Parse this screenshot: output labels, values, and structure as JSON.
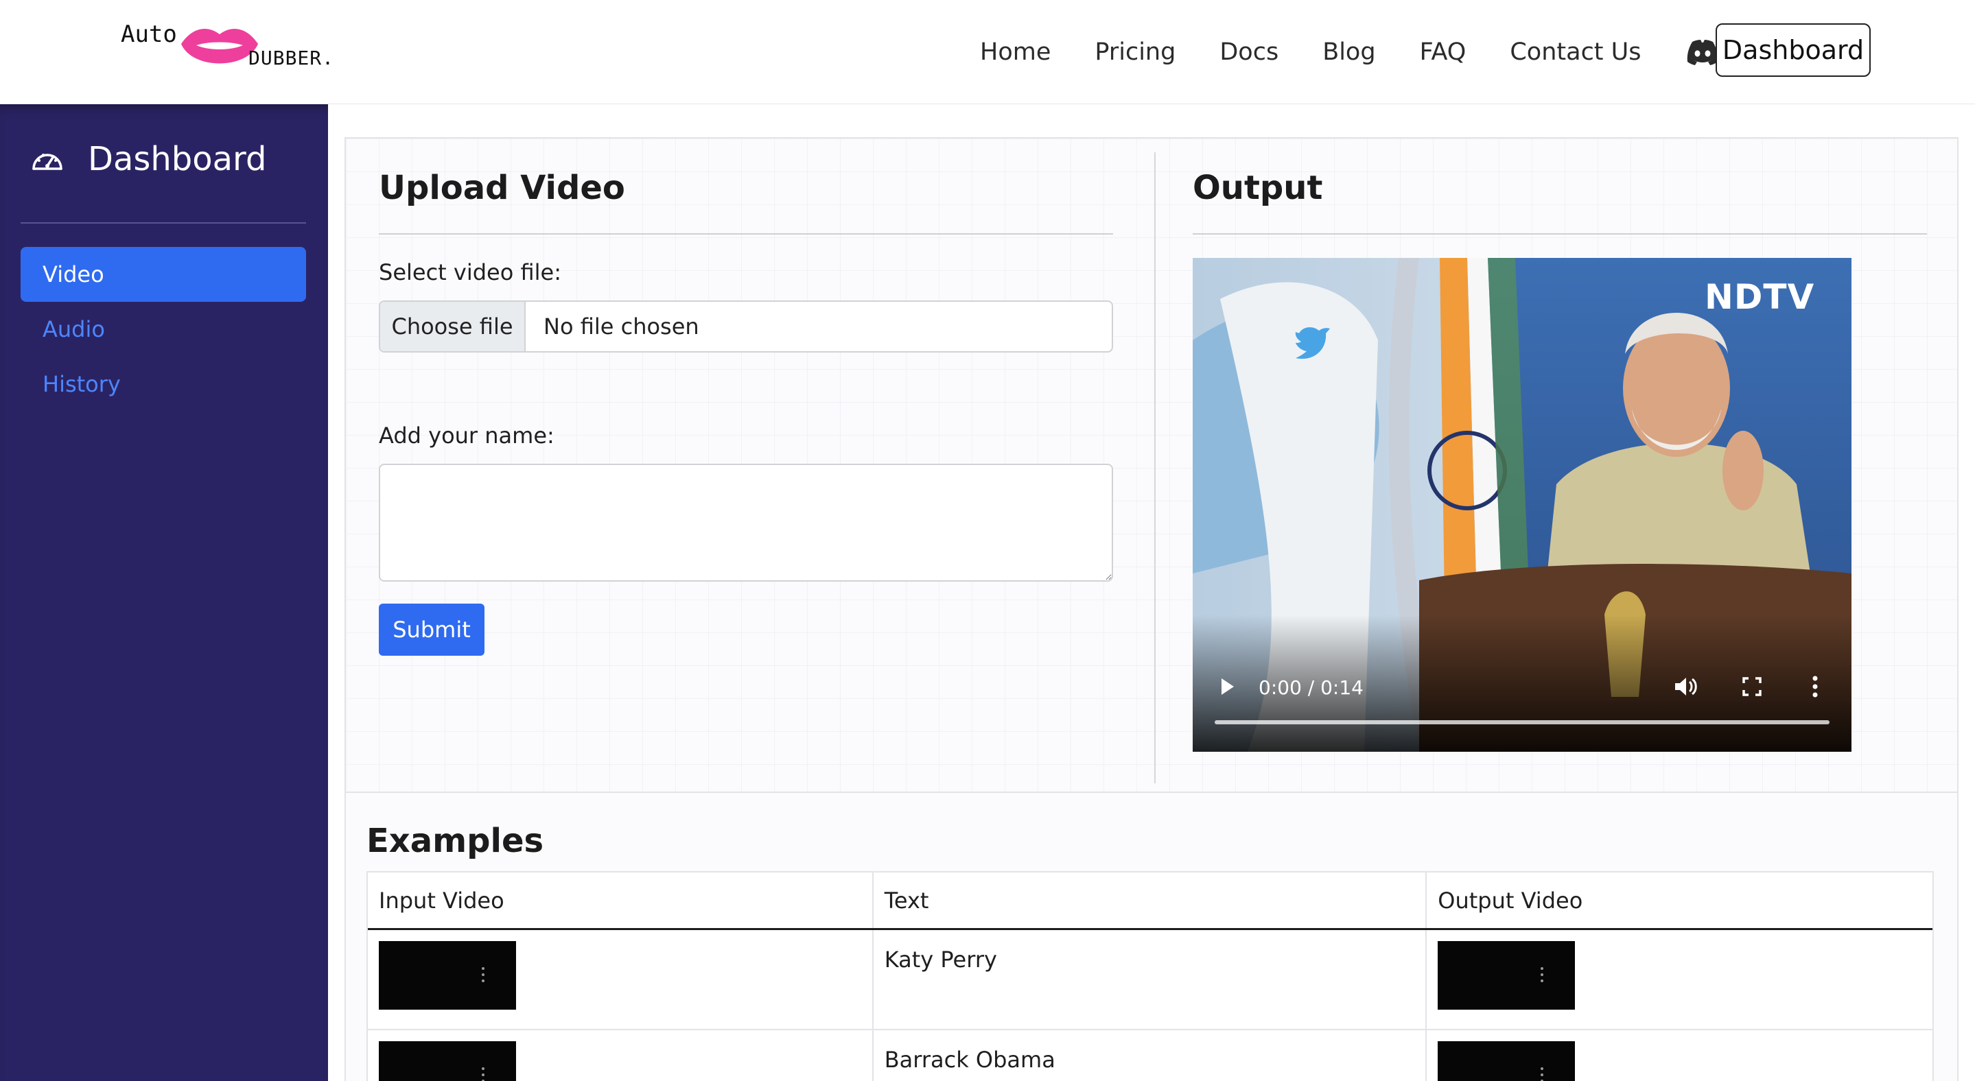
{
  "brand": {
    "logo_top": "Auto",
    "logo_bottom": "DUBBER."
  },
  "nav": {
    "links": [
      "Home",
      "Pricing",
      "Docs",
      "Blog",
      "FAQ",
      "Contact Us"
    ],
    "discord_icon": "discord-icon",
    "dashboard_button": "Dashboard"
  },
  "sidebar": {
    "title": "Dashboard",
    "title_icon": "speedometer-icon",
    "items": [
      {
        "label": "Video",
        "active": true
      },
      {
        "label": "Audio",
        "active": false
      },
      {
        "label": "History",
        "active": false
      }
    ]
  },
  "upload": {
    "title": "Upload Video",
    "file_label": "Select video file:",
    "file_button": "Choose file",
    "file_status": "No file chosen",
    "name_label": "Add your name:",
    "name_value": "",
    "submit_label": "Submit"
  },
  "output": {
    "title": "Output",
    "video": {
      "channel_logo": "NDTV",
      "time_display": "0:00 / 0:14",
      "icons": [
        "play-icon",
        "volume-icon",
        "fullscreen-icon",
        "more-options-icon"
      ]
    }
  },
  "examples": {
    "title": "Examples",
    "columns": [
      "Input Video",
      "Text",
      "Output Video"
    ],
    "rows": [
      {
        "text": "Katy Perry"
      },
      {
        "text": "Barrack Obama"
      }
    ]
  },
  "colors": {
    "sidebar_bg": "#2a2363",
    "accent_blue": "#2f6bf0",
    "link_blue": "#4c86ff",
    "logo_lips": "#ee3f9c"
  }
}
